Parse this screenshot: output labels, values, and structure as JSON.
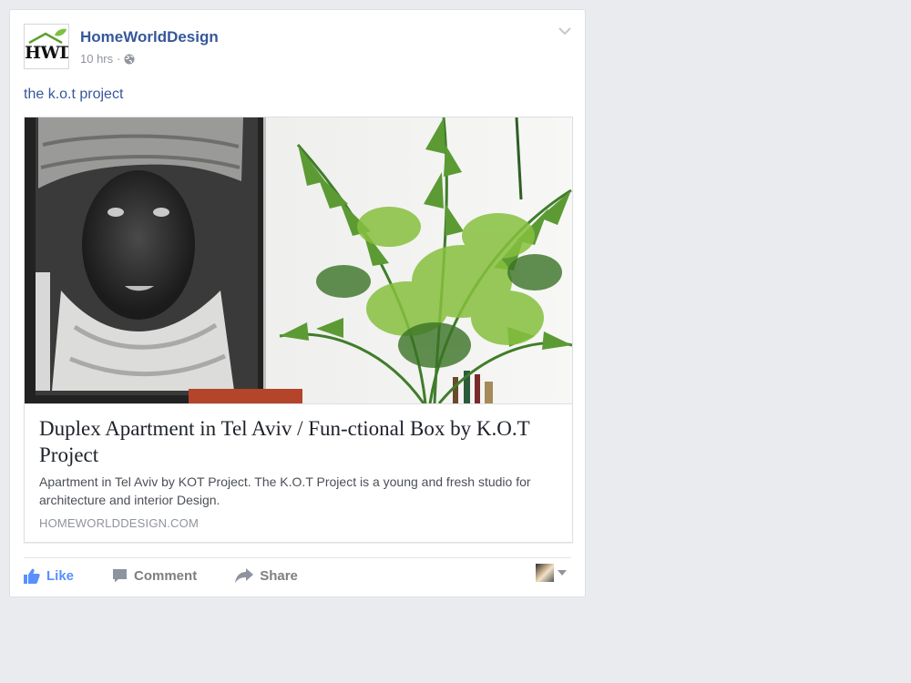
{
  "post": {
    "page": {
      "name": "HomeWorldDesign",
      "logo_text": "HWD"
    },
    "meta": {
      "time": "10 hrs",
      "separator": "·",
      "privacy_icon": "globe-icon"
    },
    "text": "the k.o.t project",
    "link": {
      "title": "Duplex Apartment in Tel Aviv / Fun-ctional Box by K.O.T Project",
      "description": "Apartment in Tel Aviv by KOT Project. The K.O.T Project is a young and fresh studio for architecture and interior Design.",
      "domain": "HOMEWORLDDESIGN.COM"
    },
    "actions": {
      "like": "Like",
      "comment": "Comment",
      "share": "Share"
    }
  },
  "colors": {
    "page_bg": "#e9ebee",
    "link_blue": "#365899",
    "like_blue": "#5890ff",
    "muted": "#90949c"
  }
}
